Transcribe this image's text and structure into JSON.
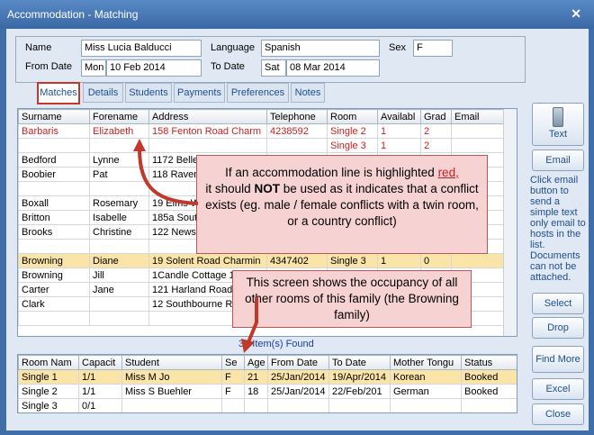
{
  "window": {
    "title": "Accommodation - Matching",
    "close_glyph": "✕"
  },
  "header": {
    "name_label": "Name",
    "name_value": "Miss Lucia Balducci",
    "language_label": "Language",
    "language_value": "Spanish",
    "sex_label": "Sex",
    "sex_value": "F",
    "from_label": "From Date",
    "from_day": "Mon",
    "from_date": "10 Feb 2014",
    "to_label": "To Date",
    "to_day": "Sat",
    "to_date": "08 Mar 2014"
  },
  "tabs": [
    "Matches",
    "Details",
    "Students",
    "Payments",
    "Preferences",
    "Notes"
  ],
  "matches": {
    "columns": [
      "Surname",
      "Forename",
      "Address",
      "Telephone",
      "Room",
      "Availabl",
      "Grad",
      "Email"
    ],
    "rows": [
      [
        "Barbaris",
        "Elizabeth",
        "158 Fenton Road Charm",
        "4238592",
        "Single 2",
        "1",
        "2",
        ""
      ],
      [
        "",
        "",
        "",
        "",
        "Single 3",
        "1",
        "2",
        ""
      ],
      [
        "Bedford",
        "Lynne",
        "1172 Belle",
        "",
        "",
        "",
        "",
        ""
      ],
      [
        "Boobier",
        "Pat",
        "118 Raven",
        "",
        "",
        "",
        "",
        ""
      ],
      [
        "",
        "",
        "",
        "",
        "",
        "",
        "",
        ""
      ],
      [
        "Boxall",
        "Rosemary",
        "19 Elms W",
        "",
        "",
        "",
        "",
        ""
      ],
      [
        "Britton",
        "Isabelle",
        "185a South",
        "",
        "",
        "",
        "",
        ""
      ],
      [
        "Brooks",
        "Christine",
        "122 Newst",
        "",
        "",
        "",
        "",
        ""
      ],
      [
        "",
        "",
        "",
        "",
        "",
        "",
        "",
        ""
      ],
      [
        "Browning",
        "Diane",
        "19 Solent Road Charmin",
        "4347402",
        "Single 3",
        "1",
        "0",
        ""
      ],
      [
        "Browning",
        "Jill",
        "1Candle Cottage 11",
        "",
        "",
        "",
        "",
        ""
      ],
      [
        "Carter",
        "Jane",
        "121 Harland Road C",
        "",
        "",
        "",
        "",
        ""
      ],
      [
        "Clark",
        "",
        "12 Southbourne Ro",
        "",
        "",
        "",
        "",
        ""
      ],
      [
        "",
        "",
        "",
        "",
        "",
        "",
        "",
        ""
      ]
    ]
  },
  "found_text": "32 Item(s) Found",
  "rooms": {
    "columns": [
      "Room Nam",
      "Capacit",
      "Student",
      "Se",
      "Age",
      "From Date",
      "To Date",
      "Mother Tongu",
      "Status"
    ],
    "rows": [
      [
        "Single 1",
        "1/1",
        "Miss M Jo",
        "F",
        "21",
        "25/Jan/2014",
        "19/Apr/2014",
        "Korean",
        "Booked"
      ],
      [
        "Single 2",
        "1/1",
        "Miss S Buehler",
        "F",
        "18",
        "25/Jan/2014",
        "22/Feb/201",
        "German",
        "Booked"
      ],
      [
        "Single 3",
        "0/1",
        "",
        "",
        "",
        "",
        "",
        "",
        ""
      ]
    ]
  },
  "side": {
    "text_label": "Text",
    "email_label": "Email",
    "email_note": "Click email button to send a simple text only email to hosts in the list. Documents can not be attached.",
    "select_label": "Select",
    "drop_label": "Drop",
    "more_label": "Find More",
    "excel_label": "Excel",
    "close_label": "Close"
  },
  "callouts": {
    "red_pre": "If an accommodation line is highlighted ",
    "red_word": "red,",
    "red_mid": "it should ",
    "red_bold": "NOT",
    "red_post": " be used as it indicates that a conflict exists (eg. male / female conflicts with a twin room, or a country conflict)",
    "family": "This screen shows the occupancy of all other rooms of this family (the Browning family)"
  },
  "colors": {
    "conflict_red": "#d01c1c",
    "highlight_row": "#fbe4a8",
    "callout_bg": "#f6d2d2"
  }
}
